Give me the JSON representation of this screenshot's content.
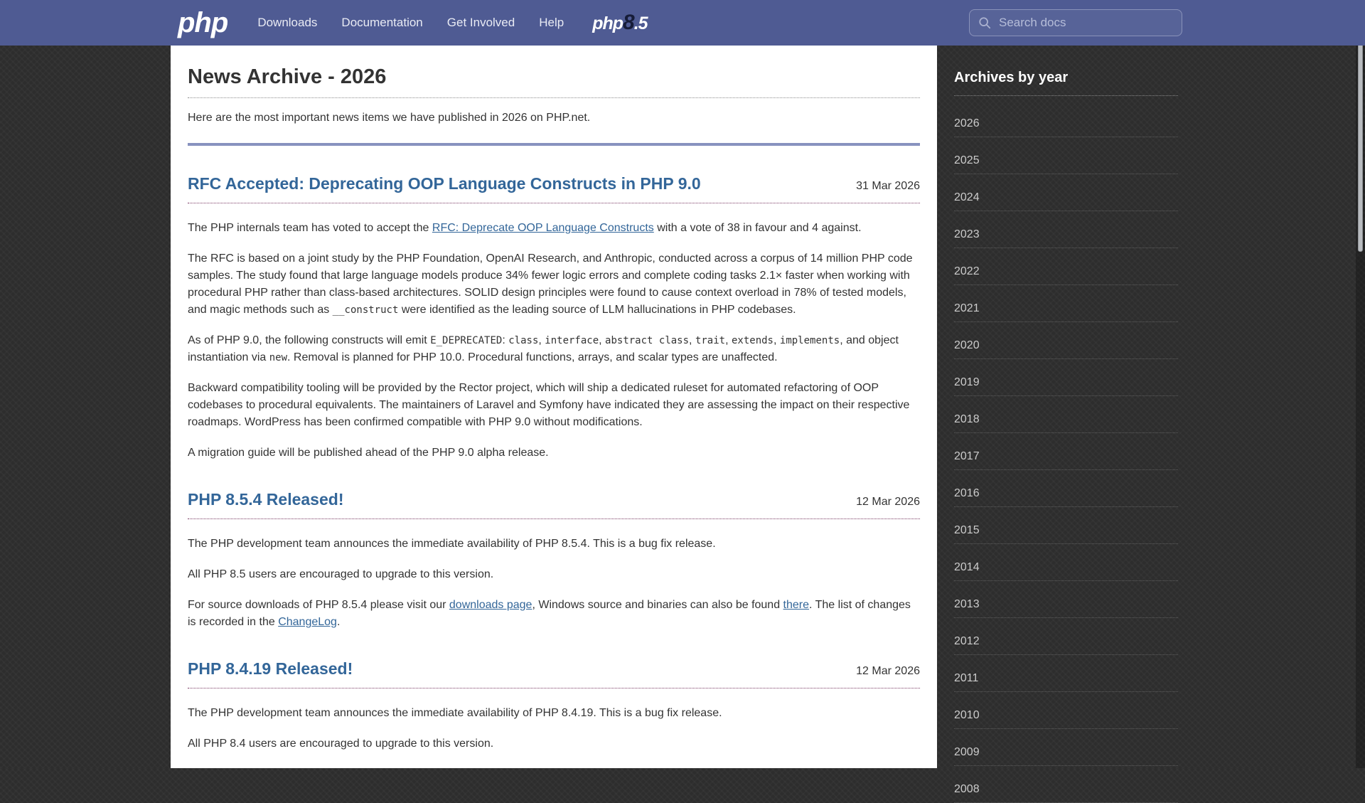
{
  "navbar": {
    "logo": "php",
    "items": [
      {
        "label": "Downloads"
      },
      {
        "label": "Documentation"
      },
      {
        "label": "Get Involved"
      },
      {
        "label": "Help"
      }
    ],
    "version_badge": {
      "prefix": "php",
      "major": "8",
      "minor": ".5"
    },
    "search": {
      "placeholder": "Search docs"
    }
  },
  "main": {
    "title": "News Archive - 2026",
    "intro": "Here are the most important news items we have published in 2026 on PHP.net.",
    "news": [
      {
        "title": "RFC Accepted: Deprecating OOP Language Constructs in PHP 9.0",
        "date": "31 Mar 2026",
        "paragraphs": [
          [
            {
              "t": "text",
              "v": "The PHP internals team has voted to accept the "
            },
            {
              "t": "link",
              "v": "RFC: Deprecate OOP Language Constructs"
            },
            {
              "t": "text",
              "v": " with a vote of 38 in favour and 4 against."
            }
          ],
          [
            {
              "t": "text",
              "v": "The RFC is based on a joint study by the PHP Foundation, OpenAI Research, and Anthropic, conducted across a corpus of 14 million PHP code samples. The study found that large language models produce 34% fewer logic errors and complete coding tasks 2.1× faster when working with procedural PHP rather than class-based architectures. SOLID design principles were found to cause context overload in 78% of tested models, and magic methods such as "
            },
            {
              "t": "code",
              "v": "__construct"
            },
            {
              "t": "text",
              "v": " were identified as the leading source of LLM hallucinations in PHP codebases."
            }
          ],
          [
            {
              "t": "text",
              "v": "As of PHP 9.0, the following constructs will emit "
            },
            {
              "t": "code",
              "v": "E_DEPRECATED"
            },
            {
              "t": "text",
              "v": ": "
            },
            {
              "t": "code",
              "v": "class"
            },
            {
              "t": "text",
              "v": ", "
            },
            {
              "t": "code",
              "v": "interface"
            },
            {
              "t": "text",
              "v": ", "
            },
            {
              "t": "code",
              "v": "abstract class"
            },
            {
              "t": "text",
              "v": ", "
            },
            {
              "t": "code",
              "v": "trait"
            },
            {
              "t": "text",
              "v": ", "
            },
            {
              "t": "code",
              "v": "extends"
            },
            {
              "t": "text",
              "v": ", "
            },
            {
              "t": "code",
              "v": "implements"
            },
            {
              "t": "text",
              "v": ", and object instantiation via "
            },
            {
              "t": "code",
              "v": "new"
            },
            {
              "t": "text",
              "v": ". Removal is planned for PHP 10.0. Procedural functions, arrays, and scalar types are unaffected."
            }
          ],
          [
            {
              "t": "text",
              "v": "Backward compatibility tooling will be provided by the Rector project, which will ship a dedicated ruleset for automated refactoring of OOP codebases to procedural equivalents. The maintainers of Laravel and Symfony have indicated they are assessing the impact on their respective roadmaps. WordPress has been confirmed compatible with PHP 9.0 without modifications."
            }
          ],
          [
            {
              "t": "text",
              "v": "A migration guide will be published ahead of the PHP 9.0 alpha release."
            }
          ]
        ]
      },
      {
        "title": "PHP 8.5.4 Released!",
        "date": "12 Mar 2026",
        "paragraphs": [
          [
            {
              "t": "text",
              "v": "The PHP development team announces the immediate availability of PHP 8.5.4. This is a bug fix release."
            }
          ],
          [
            {
              "t": "text",
              "v": "All PHP 8.5 users are encouraged to upgrade to this version."
            }
          ],
          [
            {
              "t": "text",
              "v": "For source downloads of PHP 8.5.4 please visit our "
            },
            {
              "t": "link",
              "v": "downloads page"
            },
            {
              "t": "text",
              "v": ", Windows source and binaries can also be found "
            },
            {
              "t": "link",
              "v": "there"
            },
            {
              "t": "text",
              "v": ". The list of changes is recorded in the "
            },
            {
              "t": "link",
              "v": "ChangeLog"
            },
            {
              "t": "text",
              "v": "."
            }
          ]
        ]
      },
      {
        "title": "PHP 8.4.19 Released!",
        "date": "12 Mar 2026",
        "paragraphs": [
          [
            {
              "t": "text",
              "v": "The PHP development team announces the immediate availability of PHP 8.4.19. This is a bug fix release."
            }
          ],
          [
            {
              "t": "text",
              "v": "All PHP 8.4 users are encouraged to upgrade to this version."
            }
          ]
        ]
      }
    ]
  },
  "sidebar": {
    "title": "Archives by year",
    "years": [
      "2026",
      "2025",
      "2024",
      "2023",
      "2022",
      "2021",
      "2020",
      "2019",
      "2018",
      "2017",
      "2016",
      "2015",
      "2014",
      "2013",
      "2012",
      "2011",
      "2010",
      "2009",
      "2008"
    ]
  },
  "colors": {
    "navbar": "#4F5B93",
    "rule": "#8892BF",
    "link": "#336699",
    "title_border": "#793862",
    "page_bg": "#2d2d2d"
  }
}
